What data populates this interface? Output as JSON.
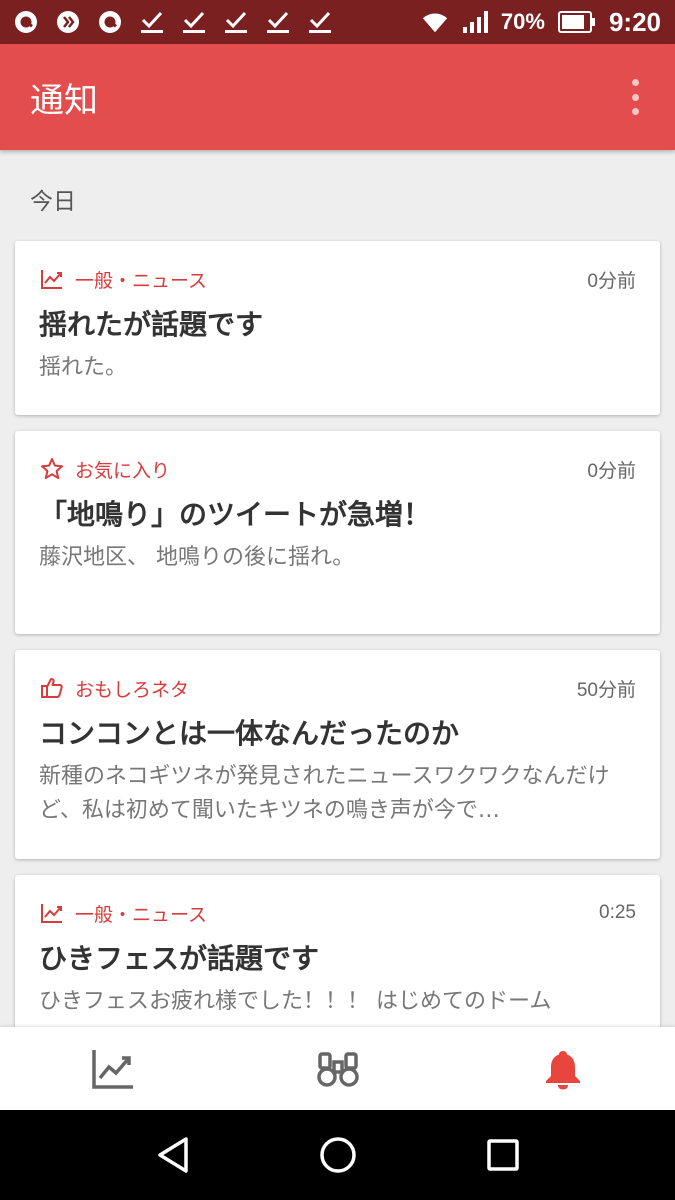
{
  "status_bar": {
    "battery": "70%",
    "time": "9:20"
  },
  "app_bar": {
    "title": "通知"
  },
  "section": {
    "label": "今日"
  },
  "notifications": [
    {
      "category": "一般・ニュース",
      "icon": "trending-icon",
      "time": "0分前",
      "title": "揺れたが話題です",
      "body": "揺れた。"
    },
    {
      "category": "お気に入り",
      "icon": "star-icon",
      "time": "0分前",
      "title": "「地鳴り」のツイートが急増！",
      "body": "藤沢地区、 地鳴りの後に揺れ。"
    },
    {
      "category": "おもしろネタ",
      "icon": "thumbs-up-icon",
      "time": "50分前",
      "title": "コンコンとは一体なんだったのか",
      "body": "新種のネコギツネが発見されたニュースワクワクなんだけど、私は初めて聞いたキツネの鳴き声が今で…"
    },
    {
      "category": "一般・ニュース",
      "icon": "trending-icon",
      "time": "0:25",
      "title": "ひきフェスが話題です",
      "body": "ひきフェスお疲れ様でした！！！ はじめてのドーム"
    }
  ],
  "bottom_nav": {
    "items": [
      "trending-icon",
      "binoculars-icon",
      "bell-icon"
    ],
    "active_color": "#e8453c",
    "inactive_color": "#666666"
  },
  "colors": {
    "status_bar": "#7a2020",
    "app_bar": "#e34d4d",
    "accent": "#d93a3a"
  }
}
